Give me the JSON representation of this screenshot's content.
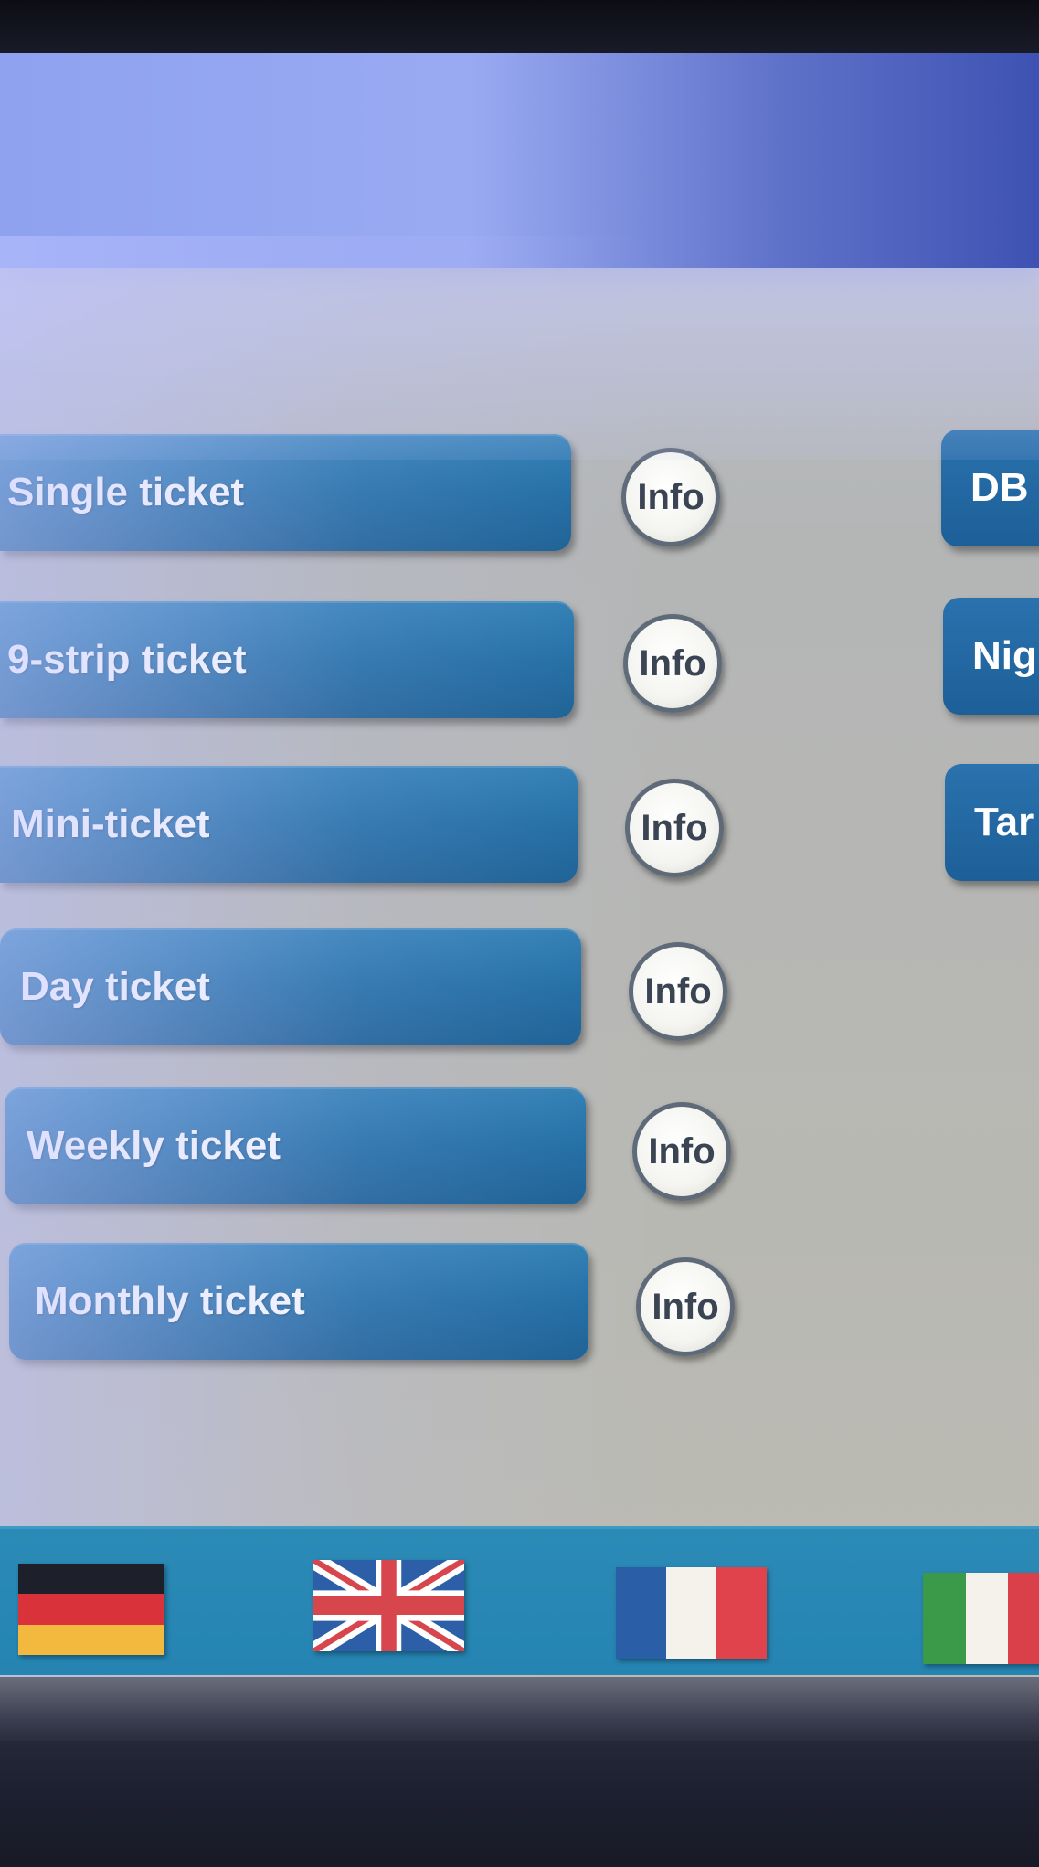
{
  "tickets_left": [
    {
      "label": "Single ticket",
      "info": "Info"
    },
    {
      "label": "9-strip ticket",
      "info": "Info"
    },
    {
      "label": "Mini-ticket",
      "info": "Info"
    },
    {
      "label": "Day ticket",
      "info": "Info"
    },
    {
      "label": "Weekly ticket",
      "info": "Info"
    },
    {
      "label": "Monthly ticket",
      "info": "Info"
    }
  ],
  "tickets_right": [
    {
      "label": "DB"
    },
    {
      "label": "Nig"
    },
    {
      "label": "Tar"
    }
  ],
  "languages": [
    "german-flag-icon",
    "uk-flag-icon",
    "french-flag-icon",
    "italian-flag-icon"
  ],
  "colors": {
    "button": "#2170a6",
    "info_circle": "#f4f4f0",
    "language_bar": "#2b8ab6",
    "header": "#8ea2f0"
  }
}
